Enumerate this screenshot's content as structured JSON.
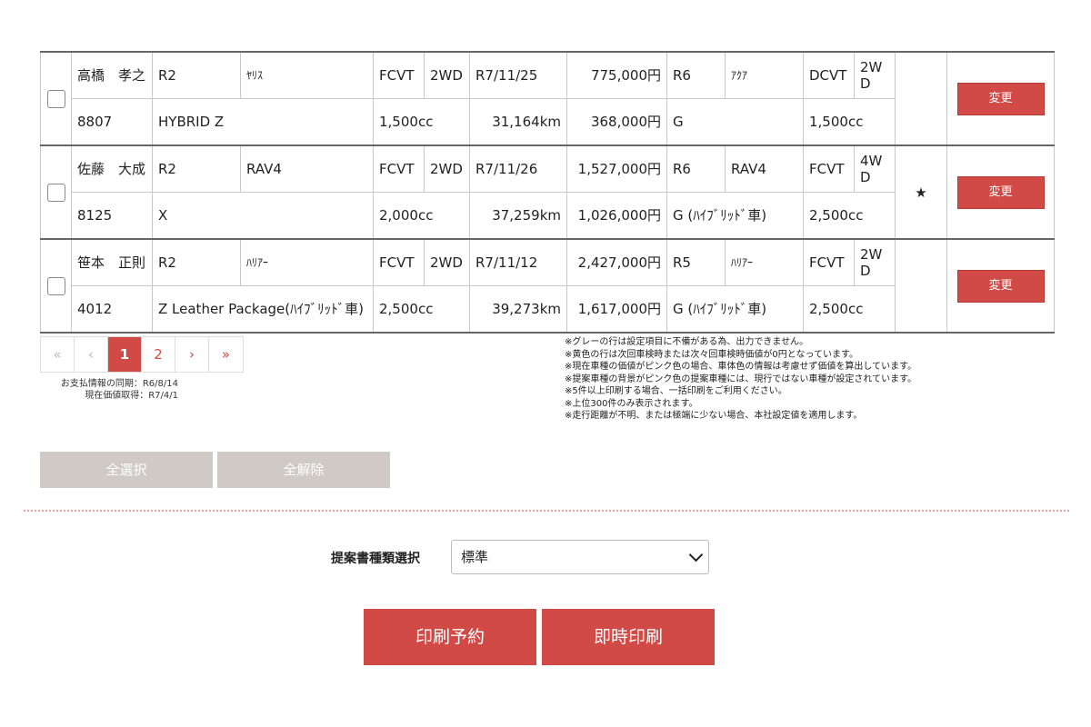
{
  "records": [
    {
      "name": "高橋　孝之",
      "id": "8807",
      "cur_year": "R2",
      "cur_model": "ﾔﾘｽ",
      "cur_grade": "HYBRID Z",
      "cur_trans": "FCVT",
      "cur_drive": "2WD",
      "cur_cc": "1,500cc",
      "inspection": "R7/11/25",
      "mileage": "31,164km",
      "price_1": "775,000円",
      "price_2": "368,000円",
      "prop_year": "R6",
      "prop_model": "ｱｸｱ",
      "prop_grade": "G",
      "prop_trans": "DCVT",
      "prop_drive": "2WD",
      "prop_cc": "1,500cc",
      "mark": "",
      "change_label": "変更"
    },
    {
      "name": "佐藤　大成",
      "id": "8125",
      "cur_year": "R2",
      "cur_model": "RAV4",
      "cur_grade": "X",
      "cur_trans": "FCVT",
      "cur_drive": "2WD",
      "cur_cc": "2,000cc",
      "inspection": "R7/11/26",
      "mileage": "37,259km",
      "price_1": "1,527,000円",
      "price_2": "1,026,000円",
      "prop_year": "R6",
      "prop_model": "RAV4",
      "prop_grade": "G (ﾊｲﾌﾞﾘｯﾄﾞ車)",
      "prop_trans": "FCVT",
      "prop_drive": "4WD",
      "prop_cc": "2,500cc",
      "mark": "★",
      "change_label": "変更"
    },
    {
      "name": "笹本　正則",
      "id": "4012",
      "cur_year": "R2",
      "cur_model": "ﾊﾘｱｰ",
      "cur_grade": "Z Leather Package(ﾊｲﾌﾞﾘｯﾄﾞ車)",
      "cur_trans": "FCVT",
      "cur_drive": "2WD",
      "cur_cc": "2,500cc",
      "inspection": "R7/11/12",
      "mileage": "39,273km",
      "price_1": "2,427,000円",
      "price_2": "1,617,000円",
      "prop_year": "R5",
      "prop_model": "ﾊﾘｱｰ",
      "prop_grade": "G (ﾊｲﾌﾞﾘｯﾄﾞ車)",
      "prop_trans": "FCVT",
      "prop_drive": "2WD",
      "prop_cc": "2,500cc",
      "mark": "",
      "change_label": "変更"
    }
  ],
  "pagination": {
    "first": "«",
    "prev": "‹",
    "pages": [
      "1",
      "2"
    ],
    "next": "›",
    "last": "»",
    "current": "1"
  },
  "sync_info": {
    "payment_sync": "お支払情報の同期：R6/8/14",
    "price_fetch": "現在価値取得：R7/4/1"
  },
  "notes": [
    "※グレーの行は設定項目に不備がある為、出力できません。",
    "※黄色の行は次回車検時または次々回車検時価値が0円となっています。",
    "※現在車種の価値がピンク色の場合、車体色の情報は考慮せず価値を算出しています。",
    "※提案車種の背景がピンク色の提案車種には、現行ではない車種が設定されています。",
    "※5件以上印刷する場合、一括印刷をご利用ください。",
    "※上位300件のみ表示されます。",
    "※走行距離が不明、または極端に少ない場合、本社設定値を適用します。"
  ],
  "selection": {
    "select_all": "全選択",
    "deselect_all": "全解除"
  },
  "proposal_type": {
    "label": "提案書種類選択",
    "selected": "標準"
  },
  "actions": {
    "reserve_print": "印刷予約",
    "instant_print": "即時印刷"
  },
  "colors": {
    "accent": "#d14a45",
    "disabled_button": "#cfcac6",
    "divider": "#e8a59e"
  }
}
